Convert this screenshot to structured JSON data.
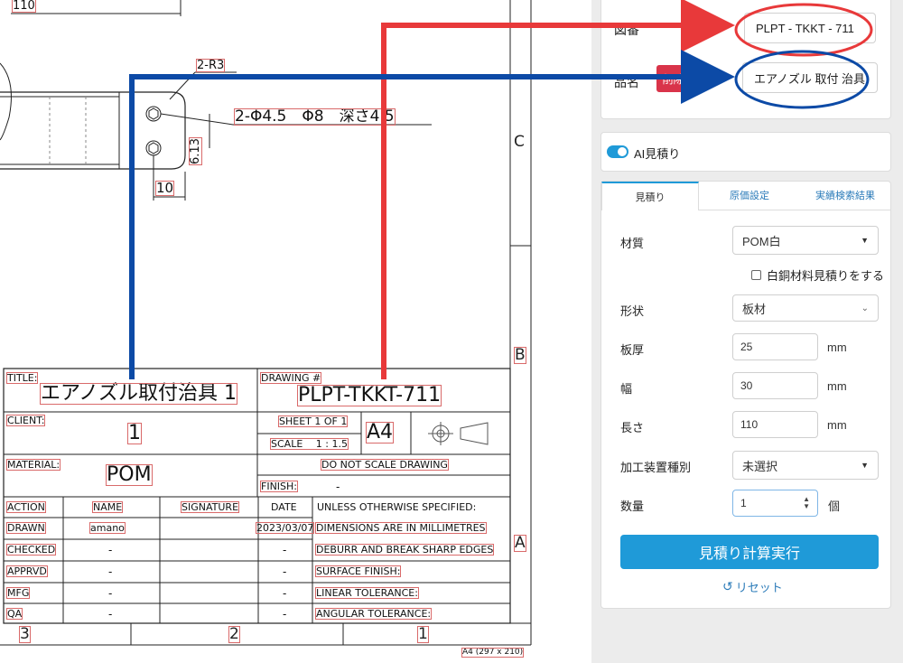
{
  "drawing": {
    "top_dim": "110",
    "radius_label": "2-R3",
    "hole_label": "2-Φ4.5　Φ8　深さ4.5",
    "pitch_label": "6.13",
    "edge_dim": "10",
    "zone_c": "C",
    "zone_b": "B",
    "zone_a": "A",
    "col_3": "3",
    "col_2": "2",
    "col_1": "1",
    "sheet_size": "A4 (297 x 210)"
  },
  "title_block": {
    "title_label": "TITLE:",
    "title_value": "エアノズル取付治具 1",
    "drawing_label": "DRAWING #",
    "drawing_value": "PLPT-TKKT-711",
    "client_label": "CLIENT:",
    "client_value": "1",
    "sheet": "SHEET 1 OF 1",
    "scale": "SCALE　 1 : 1.5",
    "paper": "A4",
    "material_label": "MATERIAL:",
    "material_value": "POM",
    "no_scale": "DO NOT SCALE DRAWING",
    "finish_label": "FINISH:",
    "finish_value": "-",
    "headers": [
      "ACTION",
      "NAME",
      "SIGNATURE",
      "DATE"
    ],
    "rows": [
      {
        "action": "DRAWN",
        "name": "amano",
        "signature": "",
        "date": "2023/03/07"
      },
      {
        "action": "CHECKED",
        "name": "-",
        "signature": "",
        "date": "-"
      },
      {
        "action": "APPRVD",
        "name": "-",
        "signature": "",
        "date": "-"
      },
      {
        "action": "MFG",
        "name": "-",
        "signature": "",
        "date": "-"
      },
      {
        "action": "QA",
        "name": "-",
        "signature": "",
        "date": "-"
      }
    ],
    "notes": [
      "UNLESS OTHERWISE SPECIFIED:",
      "DIMENSIONS ARE IN MILLIMETRES",
      "DEBURR AND BREAK SHARP EDGES",
      "SURFACE FINISH:",
      "LINEAR TOLERANCE:",
      "ANGULAR TOLERANCE:"
    ]
  },
  "panel": {
    "drawing_no_label": "図番",
    "drawing_no_value": "PLPT - TKKT - 711",
    "part_name_label": "品名",
    "delete_label": "削除",
    "part_name_value": "エアノズル 取付 治具",
    "ai_toggle_label": "AI見積り",
    "tabs": [
      "見積り",
      "原価設定",
      "実績検索結果"
    ],
    "material_label": "材質",
    "material_value": "POM白",
    "checkbox_label": "白銅材料見積りをする",
    "shape_label": "形状",
    "shape_value": "板材",
    "thickness_label": "板厚",
    "thickness_value": "25",
    "width_label": "幅",
    "width_value": "30",
    "length_label": "長さ",
    "length_value": "110",
    "unit_mm": "mm",
    "machine_label": "加工装置種別",
    "machine_value": "未選択",
    "qty_label": "数量",
    "qty_value": "1",
    "qty_unit": "個",
    "run_button": "見積り計算実行",
    "reset_label": "リセット"
  },
  "colors": {
    "accent": "#1f9ad8",
    "arrow_red": "#e8393a",
    "arrow_blue": "#0c4aa6",
    "delete_red": "#d9344a"
  }
}
